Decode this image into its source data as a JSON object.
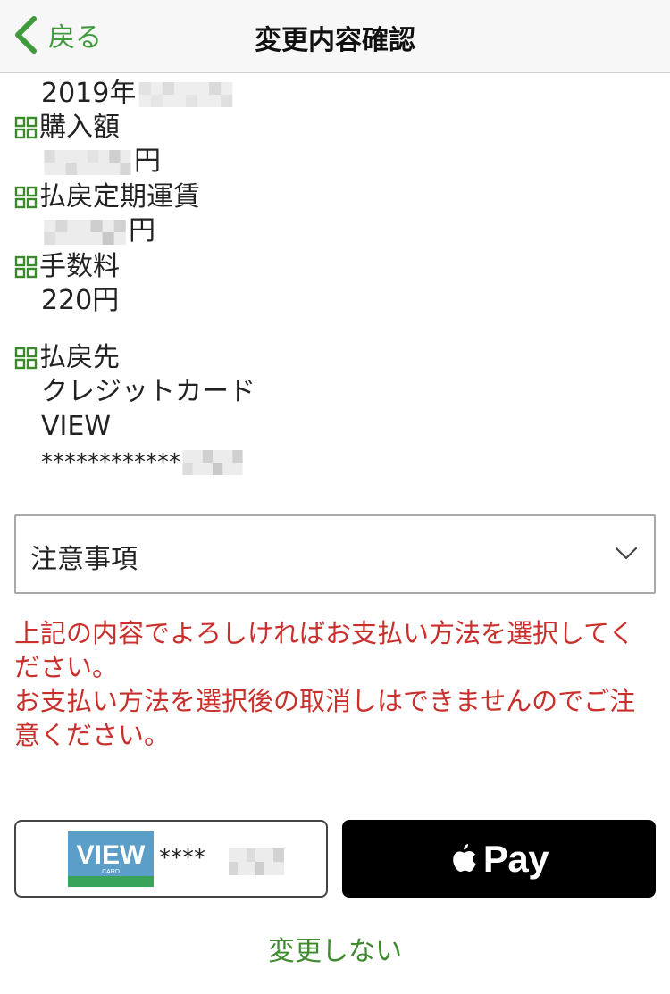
{
  "nav": {
    "back_label": "戻る",
    "title": "変更内容確認"
  },
  "date_value_prefix": "2019年",
  "purchase": {
    "label": "購入額",
    "unit": "円"
  },
  "refund_fare": {
    "label": "払戻定期運賃",
    "unit": "円"
  },
  "fee": {
    "label": "手数料",
    "value": "220円"
  },
  "refund_dest": {
    "label": "払戻先",
    "method": "クレジットカード",
    "brand": "VIEW",
    "number_mask": "************"
  },
  "notes": {
    "label": "注意事項"
  },
  "warning": {
    "line1": "上記の内容でよろしければお支払い方法を選択してください。",
    "line2": "お支払い方法を選択後の取消しはできませんのでご注意ください。"
  },
  "payment": {
    "card_mask": "****",
    "card_logo_text": "VIEW",
    "card_logo_sub": "CARD",
    "apple_pay_label": "Pay"
  },
  "cancel_label": "変更しない",
  "colors": {
    "accent_green": "#3f9a3c",
    "warning_red": "#c9302c",
    "icon_green": "#3a8a2a"
  }
}
